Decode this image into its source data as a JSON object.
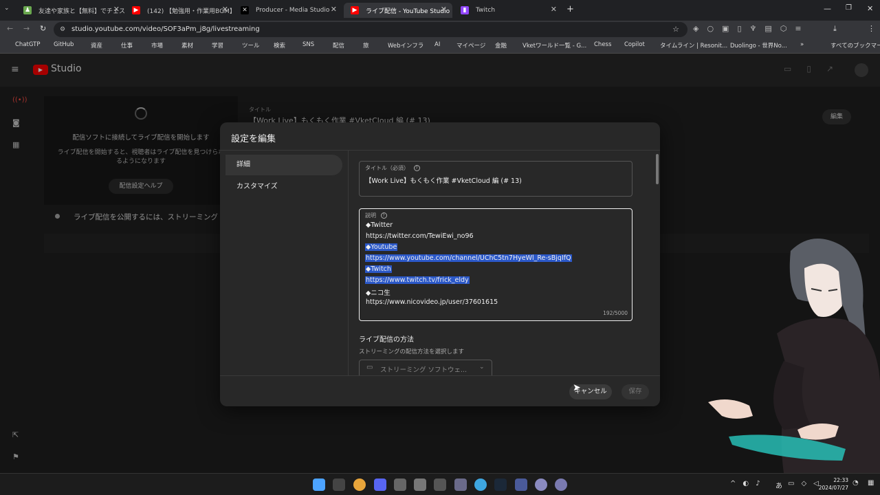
{
  "browser": {
    "tabs": [
      {
        "label": "友達や家族と【無料】でチェス対戦",
        "color": "#6aa84f"
      },
      {
        "label": "(142) 【勉強用・作業用BGM】",
        "color": "#ff0000"
      },
      {
        "label": "Producer - Media Studio",
        "color": "#000000"
      },
      {
        "label": "ライブ配信 - YouTube Studio",
        "color": "#ff0000"
      },
      {
        "label": "Twitch",
        "color": "#9146ff"
      }
    ],
    "new_tab": "+",
    "url": "studio.youtube.com/video/SOF3aPm_j8g/livestreaming",
    "bookmarks": [
      "ChatGTP",
      "GitHub",
      "資産",
      "仕事",
      "市場",
      "素材",
      "学習",
      "ツール",
      "検索",
      "SNS",
      "配信",
      "旅",
      "Webインフラ",
      "AI",
      "マイページ",
      "金融",
      "Vketワールド一覧 - G...",
      "Chess",
      "Copilot",
      "タイムライン | Resonit...",
      "Duolingo - 世界No...",
      "»",
      "すべてのブックマーク"
    ]
  },
  "studio": {
    "logo_text": "Studio",
    "bg_title_label": "タイトル",
    "bg_title": "【Work Live】もくもく作業 #VketCloud 編 (# 13)",
    "edit_button": "編集",
    "preview_line1": "配信ソフトに接続してライブ配信を開始します",
    "preview_line2": "ライブ配信を開始すると、視聴者はライブ配信を見つけられるようになります",
    "preview_help": "配信設定ヘルプ",
    "notice": "ライブ配信を公開するには、ストリーミング"
  },
  "dialog": {
    "title": "設定を編集",
    "nav": [
      "詳細",
      "カスタマイズ"
    ],
    "title_field": {
      "label": "タイトル（必須）",
      "value": "【Work Live】もくもく作業 #VketCloud 編 (# 13)"
    },
    "description": {
      "label": "説明",
      "lines": [
        {
          "text": "◆Twitter",
          "hl": false
        },
        {
          "text": "https://twitter.com/TewiEwi_no96",
          "hl": false
        },
        {
          "text": "◆Youtube",
          "hl": true
        },
        {
          "text": "https://www.youtube.com/channel/UChC5tn7HyeWl_Re-sBjqIfQ",
          "hl": true
        },
        {
          "text": "◆Twitch",
          "hl": true
        },
        {
          "text": "https://www.twitch.tv/frick_eldy",
          "hl": true
        },
        {
          "text": "◆ニコ生",
          "hl": false
        },
        {
          "text": "https://www.nicovideo.jp/user/37601615",
          "hl": false
        }
      ],
      "counter": "192/5000"
    },
    "method_heading": "ライブ配信の方法",
    "method_sub": "ストリーミングの配信方法を選択します",
    "method_select": "ストリーミング ソフトウェ...",
    "cancel": "キャンセル",
    "save": "保存"
  },
  "taskbar": {
    "time": "22:33",
    "date": "2024/07/27",
    "ime": "あ"
  },
  "colors": {
    "selection": "#2b58c8",
    "dialog_bg": "#282828",
    "accent_red": "#ff0000"
  }
}
